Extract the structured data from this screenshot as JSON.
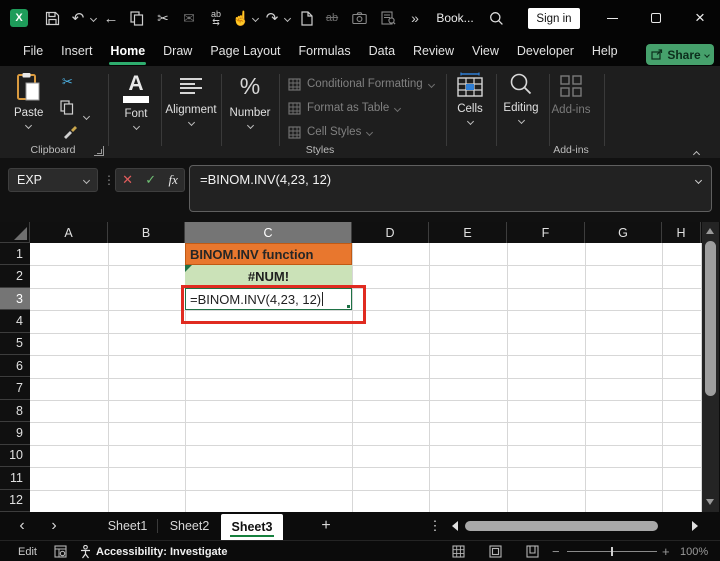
{
  "titlebar": {
    "logo_letter": "X",
    "doc_title": "Book...",
    "sign_in_label": "Sign in",
    "more_glyph": "»",
    "undo_glyph": "↶",
    "redo_glyph": "↷",
    "back_glyph": "←",
    "cut_glyph": "✂",
    "mail_glyph": "✉",
    "touch_glyph": "☝",
    "replace_text": "ab",
    "strike_text": "ab",
    "close_glyph": "×"
  },
  "ribbon": {
    "tabs": [
      "File",
      "Insert",
      "Home",
      "Draw",
      "Page Layout",
      "Formulas",
      "Data",
      "Review",
      "View",
      "Developer",
      "Help"
    ],
    "active_tab": "Home",
    "share_label": "Share",
    "clipboard": {
      "paste_label": "Paste",
      "group_label": "Clipboard",
      "cut_glyph": "✂"
    },
    "font": {
      "button_label": "Font",
      "icon_letter": "A"
    },
    "alignment": {
      "button_label": "Alignment"
    },
    "number": {
      "button_label": "Number",
      "icon_glyph": "%"
    },
    "styles": {
      "group_label": "Styles",
      "items": [
        "Conditional Formatting",
        "Format as Table",
        "Cell Styles"
      ]
    },
    "cells": {
      "button_label": "Cells"
    },
    "editing": {
      "button_label": "Editing"
    },
    "addins": {
      "button_label": "Add-ins",
      "group_label": "Add-ins"
    }
  },
  "formula_bar": {
    "name_box_value": "EXP",
    "dots_glyph": "⋮",
    "cancel_glyph": "✕",
    "enter_glyph": "✓",
    "fx_label": "fx",
    "formula": "=BINOM.INV(4,23, 12)"
  },
  "grid": {
    "visible_columns": [
      "A",
      "B",
      "C",
      "D",
      "E",
      "F",
      "G",
      "H"
    ],
    "visible_rows": [
      "1",
      "2",
      "3",
      "4",
      "5",
      "6",
      "7",
      "8",
      "9",
      "10",
      "11",
      "12"
    ],
    "selected_column": "C",
    "selected_row": "3",
    "cells": [
      {
        "ref": "C1",
        "text": "BINOM.INV function",
        "fill": "#E8772E",
        "border": "#BF5A15",
        "text_color": "#262626",
        "align": "left",
        "bold": true,
        "error_triangle": false,
        "editing": false
      },
      {
        "ref": "C2",
        "text": "#NUM!",
        "fill": "#CBE2B8",
        "border": "",
        "text_color": "#1f1f1f",
        "align": "center",
        "bold": true,
        "error_triangle": true,
        "editing": false
      },
      {
        "ref": "C3",
        "text": "=BINOM.INV(4,23, 12)",
        "fill": "#FFFFFF",
        "border": "#1E7145",
        "text_color": "#1f1f1f",
        "align": "left",
        "bold": false,
        "error_triangle": false,
        "editing": true
      }
    ],
    "annotation_color": "#E02B20"
  },
  "sheet_bar": {
    "nav_left_glyph": "‹",
    "nav_right_glyph": "›",
    "tabs": [
      "Sheet1",
      "Sheet2",
      "Sheet3"
    ],
    "active_tab": "Sheet3",
    "add_glyph": "+",
    "menu_glyph": "⋮"
  },
  "status_bar": {
    "mode": "Edit",
    "accessibility_label": "Accessibility: Investigate",
    "zoom_out_glyph": "−",
    "zoom_in_glyph": "+",
    "zoom_level": "100%"
  },
  "colors": {
    "accent_green": "#2ead6e",
    "share_green": "#46a16c",
    "orange_fill": "#E8772E",
    "green_fill": "#CBE2B8",
    "annotation_red": "#E02B20"
  }
}
